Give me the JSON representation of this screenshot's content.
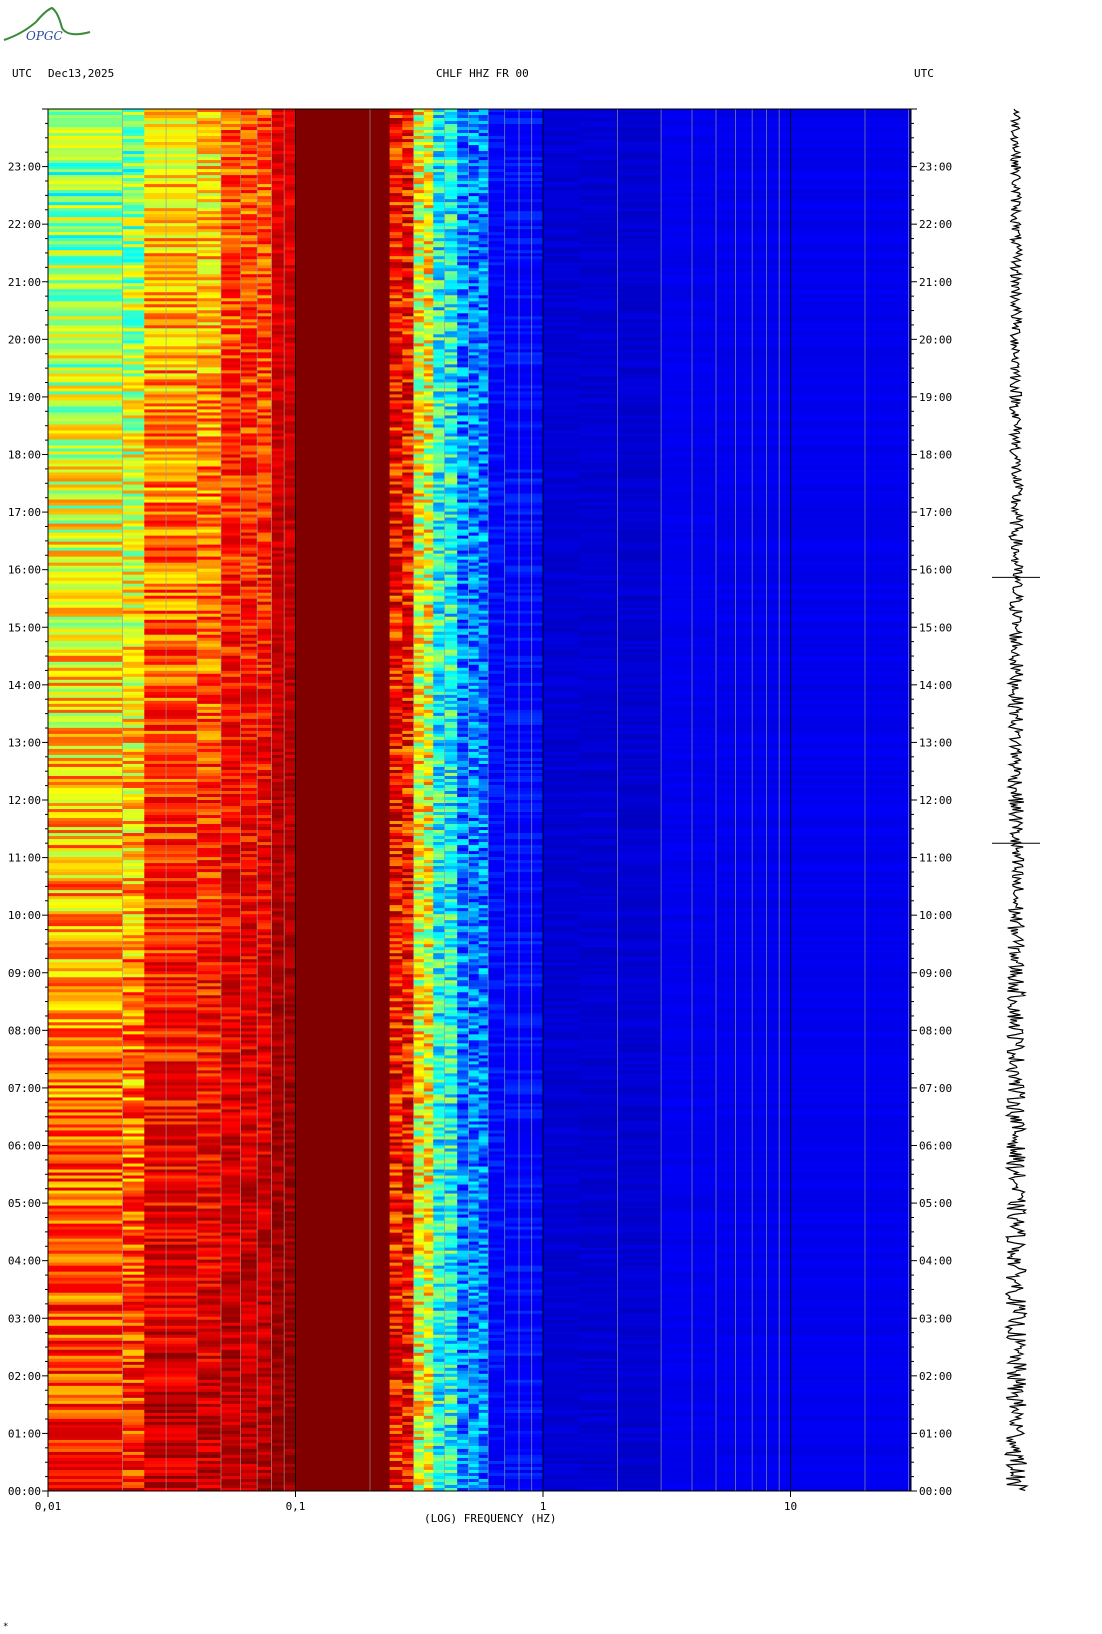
{
  "logo": {
    "text": "OPGC"
  },
  "header": {
    "left_tz": "UTC",
    "date": "Dec13,2025",
    "station": "CHLF HHZ FR 00",
    "right_tz": "UTC"
  },
  "chart_data": {
    "type": "heatmap",
    "title": "CHLF HHZ FR 00",
    "xlabel": "(LOG) FREQUENCY (HZ)",
    "ylabel": "UTC",
    "x_scale": "log",
    "xlim": [
      0.01,
      30
    ],
    "x_major_ticks": [
      0.01,
      0.1,
      1,
      10
    ],
    "x_tick_labels": [
      "0,01",
      "0,1",
      "1",
      "10"
    ],
    "y_tick_labels": [
      "00:00",
      "01:00",
      "02:00",
      "03:00",
      "04:00",
      "05:00",
      "06:00",
      "07:00",
      "08:00",
      "09:00",
      "10:00",
      "11:00",
      "12:00",
      "13:00",
      "14:00",
      "15:00",
      "16:00",
      "17:00",
      "18:00",
      "19:00",
      "20:00",
      "21:00",
      "22:00",
      "23:00"
    ],
    "colormap": [
      "#00008f",
      "#0000ff",
      "#00ffff",
      "#ffff00",
      "#ff0000",
      "#800000"
    ],
    "transients_utc": [
      "11:15",
      "15:52"
    ],
    "seismogram": true
  },
  "footer": {
    "mark": "*"
  }
}
